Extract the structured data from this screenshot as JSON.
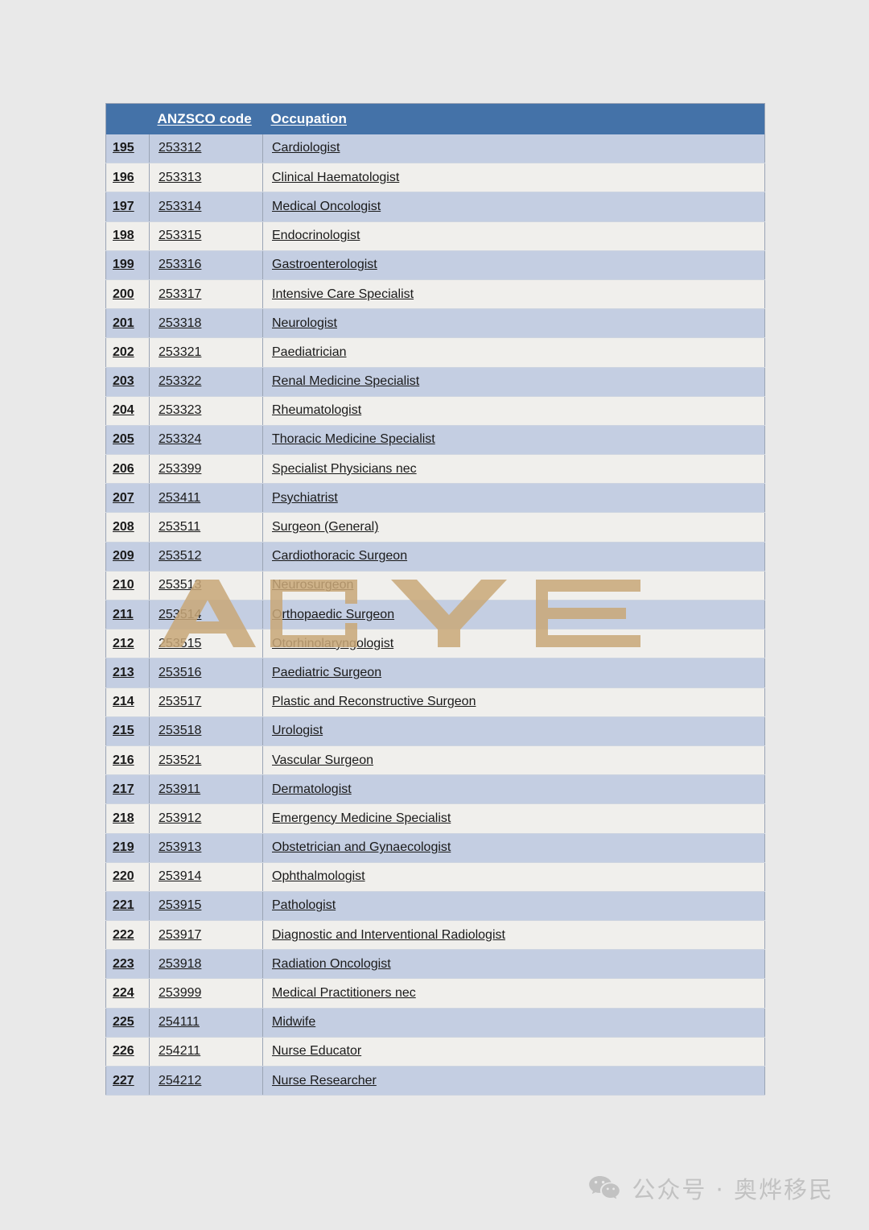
{
  "table": {
    "columns": [
      {
        "key": "index",
        "label": ""
      },
      {
        "key": "code",
        "label": "ANZSCO code"
      },
      {
        "key": "occupation",
        "label": "Occupation"
      }
    ],
    "header_bg": "#4472a8",
    "band_a_bg": "#c4cee2",
    "band_b_bg": "#f0efec",
    "rows": [
      {
        "index": "195",
        "code": "253312",
        "occupation": "Cardiologist"
      },
      {
        "index": "196",
        "code": "253313",
        "occupation": "Clinical Haematologist"
      },
      {
        "index": "197",
        "code": "253314",
        "occupation": "Medical Oncologist"
      },
      {
        "index": "198",
        "code": "253315",
        "occupation": "Endocrinologist"
      },
      {
        "index": "199",
        "code": "253316",
        "occupation": "Gastroenterologist"
      },
      {
        "index": "200",
        "code": "253317",
        "occupation": "Intensive Care Specialist"
      },
      {
        "index": "201",
        "code": "253318",
        "occupation": "Neurologist"
      },
      {
        "index": "202",
        "code": "253321",
        "occupation": "Paediatrician"
      },
      {
        "index": "203",
        "code": "253322",
        "occupation": "Renal Medicine Specialist"
      },
      {
        "index": "204",
        "code": "253323",
        "occupation": "Rheumatologist"
      },
      {
        "index": "205",
        "code": "253324",
        "occupation": "Thoracic Medicine Specialist"
      },
      {
        "index": "206",
        "code": "253399",
        "occupation": "Specialist Physicians nec"
      },
      {
        "index": "207",
        "code": "253411",
        "occupation": "Psychiatrist"
      },
      {
        "index": "208",
        "code": "253511",
        "occupation": "Surgeon (General)"
      },
      {
        "index": "209",
        "code": "253512",
        "occupation": "Cardiothoracic Surgeon"
      },
      {
        "index": "210",
        "code": "253513",
        "occupation": "Neurosurgeon"
      },
      {
        "index": "211",
        "code": "253514",
        "occupation": "Orthopaedic Surgeon"
      },
      {
        "index": "212",
        "code": "253515",
        "occupation": "Otorhinolaryngologist"
      },
      {
        "index": "213",
        "code": "253516",
        "occupation": "Paediatric Surgeon"
      },
      {
        "index": "214",
        "code": "253517",
        "occupation": "Plastic and Reconstructive Surgeon"
      },
      {
        "index": "215",
        "code": "253518",
        "occupation": "Urologist"
      },
      {
        "index": "216",
        "code": "253521",
        "occupation": "Vascular Surgeon"
      },
      {
        "index": "217",
        "code": "253911",
        "occupation": "Dermatologist"
      },
      {
        "index": "218",
        "code": "253912",
        "occupation": "Emergency Medicine Specialist"
      },
      {
        "index": "219",
        "code": "253913",
        "occupation": "Obstetrician and Gynaecologist"
      },
      {
        "index": "220",
        "code": "253914",
        "occupation": "Ophthalmologist"
      },
      {
        "index": "221",
        "code": "253915",
        "occupation": "Pathologist"
      },
      {
        "index": "222",
        "code": "253917",
        "occupation": "Diagnostic and Interventional Radiologist"
      },
      {
        "index": "223",
        "code": "253918",
        "occupation": "Radiation Oncologist"
      },
      {
        "index": "224",
        "code": "253999",
        "occupation": "Medical Practitioners nec"
      },
      {
        "index": "225",
        "code": "254111",
        "occupation": "Midwife"
      },
      {
        "index": "226",
        "code": "254211",
        "occupation": "Nurse Educator"
      },
      {
        "index": "227",
        "code": "254212",
        "occupation": "Nurse Researcher"
      }
    ]
  },
  "watermark": {
    "text": "AOYE",
    "color": "#c9a878"
  },
  "footer": {
    "icon": "wechat-icon",
    "text": "公众号 · 奥烨移民",
    "color": "#c2c2c2"
  }
}
